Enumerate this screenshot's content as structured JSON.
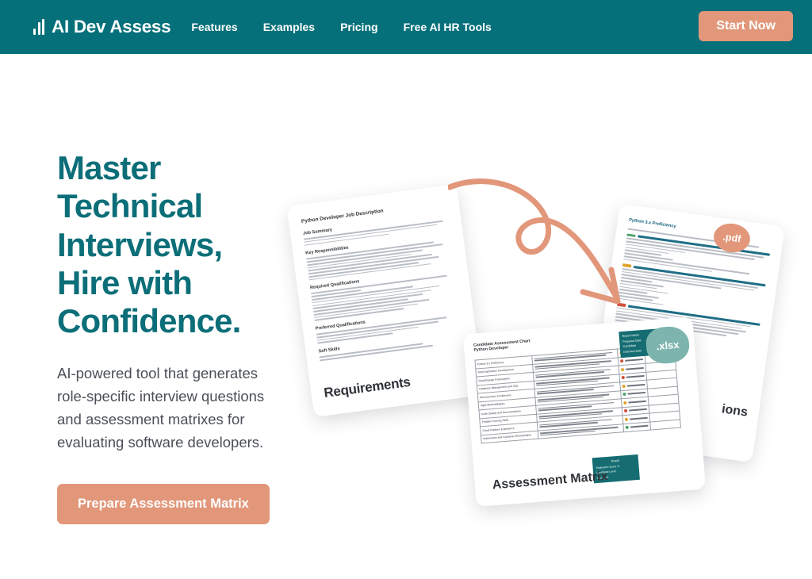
{
  "header": {
    "brand": {
      "icon": "bar-chart-icon",
      "name": "AI Dev Assess"
    },
    "nav": [
      {
        "label": "Features"
      },
      {
        "label": "Examples"
      },
      {
        "label": "Pricing"
      },
      {
        "label": "Free AI HR Tools"
      }
    ],
    "cta_label": "Start Now"
  },
  "hero": {
    "title_lines": [
      "Master",
      "Technical",
      "Interviews,",
      "Hire with",
      "Confidence."
    ],
    "subtitle": "AI-powered tool that generates role-specific interview questions and assessment matrixes for evaluating software developers.",
    "cta_label": "Prepare Assessment Matrix"
  },
  "illustration": {
    "job_description": {
      "title": "Python Developer Job Description",
      "sections": [
        "Job Summary",
        "Key Responsibilities",
        "Required Qualifications",
        "Preferred Qualifications",
        "Soft Skills"
      ],
      "caption": "Requirements"
    },
    "questions_doc": {
      "title": "Python 3.x Proficiency",
      "caption": "ions",
      "badge": ".pdf"
    },
    "assessment_matrix": {
      "title_line1": "Candidate Assessment Chart",
      "title_line2": "Python Developer",
      "caption": "Assessment Matrix",
      "badge": ".xlsx",
      "header_box": [
        "Report Name",
        "Prepared Date",
        "Candidate",
        "Interview Date"
      ],
      "result_box": {
        "title": "Result",
        "rows": [
          "Evaluation Score %",
          "Candidate Level",
          "Comment"
        ]
      },
      "criteria": [
        "Python 3.x Proficiency",
        "Web Application Development",
        "Flask/Django Frameworks",
        "Database Management and SQL",
        "Microservices Architecture",
        "Agile Methodologies",
        "Code Quality and Documentation",
        "Problem-Solving Skills",
        "Cloud Platform Experience",
        "Kubernetes and Container Orchestration"
      ]
    },
    "arrow": "curved-arrow-icon"
  },
  "colors": {
    "teal": "#05707A",
    "heading_teal": "#0C6E78",
    "coral": "#E2977A",
    "sage": "#7DB5AE",
    "body_text": "#4A4F57"
  }
}
